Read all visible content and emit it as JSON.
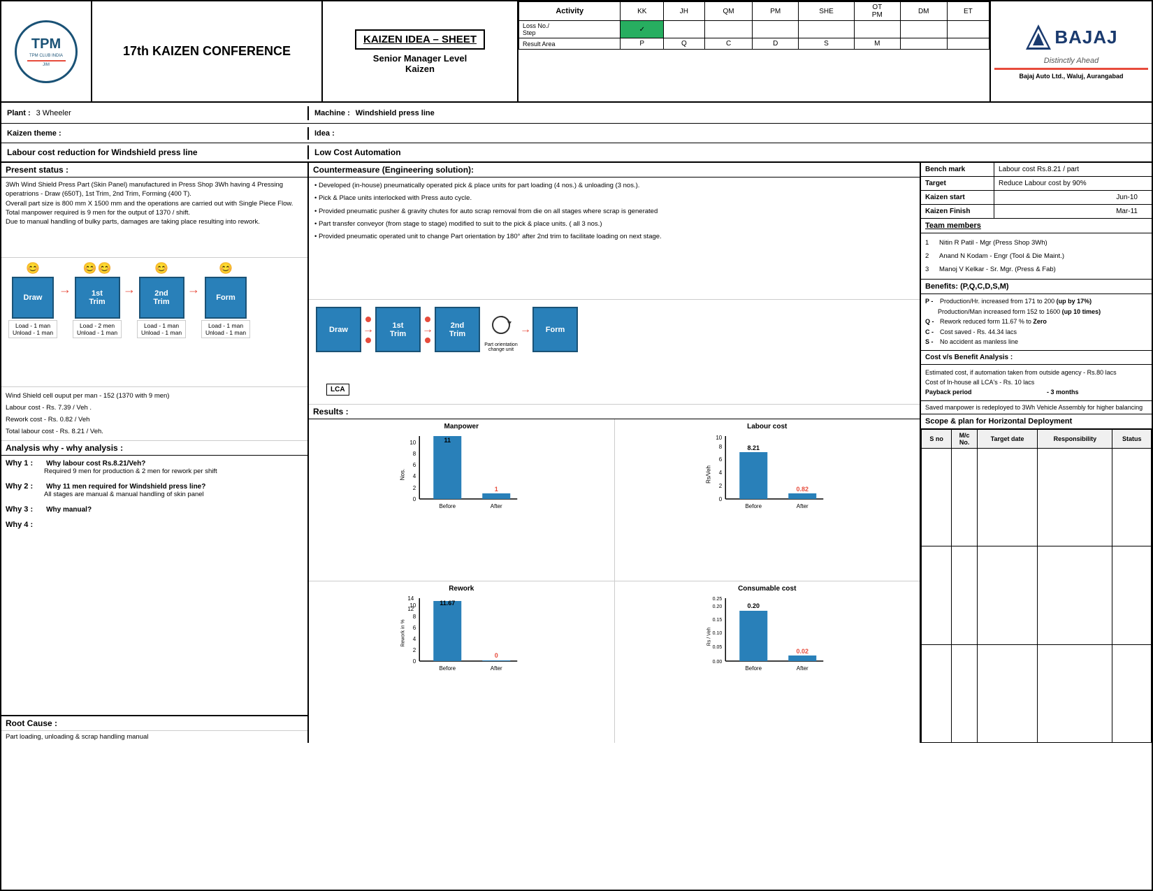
{
  "header": {
    "conference_title": "17th KAIZEN CONFERENCE",
    "kaizen_sheet_title": "KAIZEN IDEA – SHEET",
    "level_text": "Senior Manager Level",
    "kaizen_label": "Kaizen",
    "activity_label": "Activity",
    "columns": [
      "KK",
      "JH",
      "QM",
      "PM",
      "SHE",
      "OT PM",
      "DM",
      "ET"
    ],
    "row1_label": "Loss No./\nStep",
    "row2_label": "Result Area",
    "result_values": [
      "P",
      "Q",
      "C",
      "D",
      "S",
      "M"
    ],
    "result_highlight": "C",
    "bajaj_name": "BAJAJ",
    "bajaj_tagline": "Distinctly Ahead",
    "bajaj_address": "Bajaj Auto Ltd., Waluj, Aurangabad"
  },
  "plant": {
    "label": "Plant :",
    "value": "3 Wheeler",
    "machine_label": "Machine :",
    "machine_value": "Windshield press line"
  },
  "kaizen_theme": {
    "label": "Kaizen theme :",
    "idea_label": "Idea :",
    "theme_value": "Labour cost reduction for Windshield press line",
    "idea_value": "Low Cost Automation"
  },
  "present_status": {
    "header": "Present status :",
    "text": "3Wh Wind Shield Press Part (Skin Panel) manufactured in Press Shop 3Wh having 4 Pressing operatrions - Draw (650T), 1st Trim, 2nd Trim, Forming (400 T).\nOverall part size is 800 mm X 1500 mm and the operations are carried out with Single Piece Flow.\nTotal manpower required is 9 men for the output of 1370 / shift.\nDue to manual handling of bulky parts, damages are taking place resulting into rework."
  },
  "process_flow": {
    "steps": [
      "Draw",
      "1st\nTrim",
      "2nd\nTrim",
      "Form"
    ],
    "smileys_before": [
      1,
      2,
      1,
      1
    ],
    "man_labels": [
      {
        "load": "Load  - 1 man",
        "unload": "Unload - 1 man"
      },
      {
        "load": "Load  - 2 men",
        "unload": "Unload - 1 man"
      },
      {
        "load": "Load  - 1 man",
        "unload": "Unload - 1 man"
      },
      {
        "load": "Load  - 1 man",
        "unload": "Unload - 1 man"
      }
    ]
  },
  "metrics": {
    "output": "Wind Shield cell ouput per man - 152 (1370 with 9 men)",
    "labour_cost": "Labour cost       - Rs. 7.39 /  Veh .",
    "rework_cost": "Rework cost       - Rs. 0.82 / Veh",
    "total": "Total labour cost  - Rs. 8.21 / Veh."
  },
  "analysis": {
    "header": "Analysis why - why analysis :",
    "why1_label": "Why 1 :",
    "why1_q": "Why labour cost Rs.8.21/Veh?",
    "why1_a": "Required 9 men for production & 2 men for rework per shift",
    "why2_label": "Why 2 :",
    "why2_q": "Why 11 men required for Windshield press line?",
    "why2_a": "All stages are manual & manual handling of skin panel",
    "why3_label": "Why 3 :",
    "why3_q": "Why manual?",
    "why4_label": "Why 4 :"
  },
  "root_cause": {
    "header": "Root Cause :",
    "text": "Part loading, unloading & scrap handling manual"
  },
  "countermeasure": {
    "header": "Countermeasure (Engineering solution):",
    "points": [
      "• Developed (in-house) pneumatically operated pick & place units for part loading (4 nos.) & unloading (3 nos.).",
      "• Pick & Place units interlocked with Press auto cycle.",
      "• Provided pneumatic pusher & gravity chutes for auto scrap removal from die on all stages where scrap is generated",
      "• Part transfer conveyor (from stage to stage) modified to suit to the pick & place units. ( all 3 nos.)",
      "• Provided pneumatic operated unit to change Part orientation by 180° after 2nd trim to facilitate loading on next stage."
    ]
  },
  "after_process": {
    "steps": [
      "Draw",
      "1st\nTrim",
      "2nd\nTrim",
      "Form"
    ],
    "lca_label": "LCA",
    "orientation_label": "Part orientation\nchange unit"
  },
  "results": {
    "header": "Results :",
    "manpower_chart": {
      "title": "Manpower",
      "y_label": "Nos.",
      "before_value": 11,
      "after_value": 1,
      "before_label": "Before",
      "after_label": "After",
      "y_max": 12
    },
    "labour_cost_chart": {
      "title": "Labour cost",
      "y_label": "Rs/Veh",
      "before_value": 8.21,
      "after_value": 0.82,
      "before_label": "Before",
      "after_label": "After",
      "y_max": 10
    },
    "rework_chart": {
      "title": "Rework",
      "y_label": "Rework in %",
      "before_value": 11.67,
      "after_value": 0,
      "before_label": "Before",
      "after_label": "After",
      "y_max": 14
    },
    "consumable_chart": {
      "title": "Consumable cost",
      "y_label": "Rs / Veh",
      "before_value": 0.2,
      "after_value": 0.02,
      "before_label": "Before",
      "after_label": "After",
      "y_max": 0.25
    }
  },
  "bench_mark": {
    "label": "Bench mark",
    "value": "Labour cost Rs.8.21 / part"
  },
  "target": {
    "label": "Target",
    "value": "Reduce Labour cost by 90%"
  },
  "kaizen_start": {
    "label": "Kaizen start",
    "value": "Jun-10"
  },
  "kaizen_finish": {
    "label": "Kaizen Finish",
    "value": "Mar-11"
  },
  "team_members": {
    "header": "Team members",
    "members": [
      {
        "num": "1",
        "name": "Nitin R Patil - Mgr (Press Shop 3Wh)"
      },
      {
        "num": "2",
        "name": "Anand N Kodam - Engr (Tool & Die Maint.)"
      },
      {
        "num": "3",
        "name": "Manoj V Kelkar - Sr. Mgr. (Press & Fab)"
      }
    ]
  },
  "benefits": {
    "header": "Benefits: (P,Q,C,D,S,M)",
    "items": [
      {
        "letter": "P -",
        "text": "Production/Hr. increased from 171 to 200 (up by 17%)"
      },
      {
        "letter": "",
        "text": "Production/Man increased form 152 to 1600 (up 10 times)"
      },
      {
        "letter": "Q -",
        "text": "Rework reduced form 11.67 % to Zero"
      },
      {
        "letter": "C -",
        "text": "Cost saved - Rs. 44.34 lacs"
      },
      {
        "letter": "S -",
        "text": "No accident as manless line"
      }
    ]
  },
  "cost_analysis": {
    "header": "Cost v/s Benefit Analysis :",
    "line1": "Estimated cost, if automation taken from outside agency - Rs.80 lacs",
    "line2": "Cost of In-house all LCA's                                              - Rs. 10 lacs",
    "payback": "Payback period                                                           - 3 months",
    "saved_text": "Saved manpower is redeployed to 3Wh Vehicle Assembly for higher balancing"
  },
  "scope": {
    "header": "Scope & plan for Horizontal Deployment",
    "columns": [
      "S no",
      "M/c\nNo.",
      "Target date",
      "Responsibility",
      "Status"
    ]
  }
}
